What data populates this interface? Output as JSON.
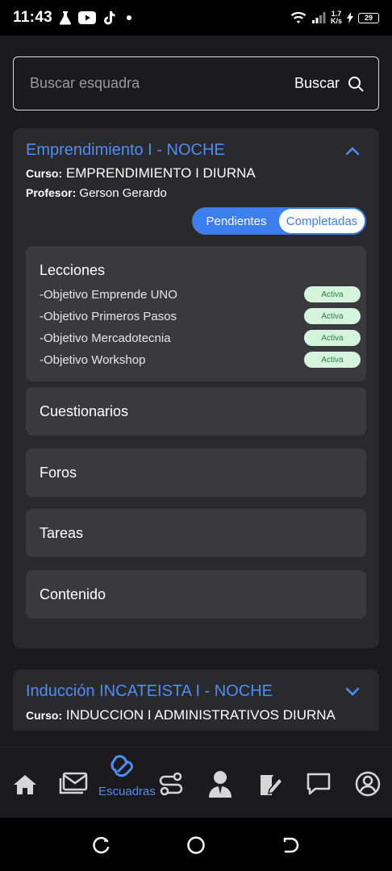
{
  "status_bar": {
    "time": "11:43",
    "net_speed_value": "1.7",
    "net_speed_unit": "K/s",
    "battery": "29"
  },
  "search": {
    "placeholder": "Buscar esquadra",
    "button_label": "Buscar"
  },
  "courses": [
    {
      "title": "Emprendimiento I - NOCHE",
      "curso_label": "Curso:",
      "curso_value": "EMPRENDIMIENTO I DIURNA",
      "profesor_label": "Profesor:",
      "profesor_value": "Gerson Gerardo",
      "expanded": true,
      "toggle": {
        "pending": "Pendientes",
        "completed": "Completadas",
        "selected": "Pendientes"
      },
      "lessons_title": "Lecciones",
      "lessons": [
        {
          "name": "-Objetivo Emprende UNO",
          "status": "Activa"
        },
        {
          "name": "-Objetivo Primeros Pasos",
          "status": "Activa"
        },
        {
          "name": "-Objetivo Mercadotecnia",
          "status": "Activa"
        },
        {
          "name": "-Objetivo Workshop",
          "status": "Activa"
        }
      ],
      "sections": [
        "Cuestionarios",
        "Foros",
        "Tareas",
        "Contenido"
      ]
    },
    {
      "title": "Inducción INCATEISTA I - NOCHE",
      "curso_label": "Curso:",
      "curso_value": "INDUCCION I ADMINISTRATIVOS DIURNA",
      "expanded": false
    }
  ],
  "bottom_nav": {
    "active_label": "Escuadras",
    "items": [
      "home-icon",
      "mail-icon",
      "squads-icon",
      "routes-icon",
      "teacher-icon",
      "assignment-icon",
      "chat-icon",
      "profile-icon"
    ]
  },
  "colors": {
    "accent": "#4f8cf5",
    "background": "#1b1b1d",
    "card": "#2a2a2d",
    "panel": "#3a3a3e",
    "badge_bg": "#d4f5dc",
    "badge_text": "#2f7a45"
  }
}
